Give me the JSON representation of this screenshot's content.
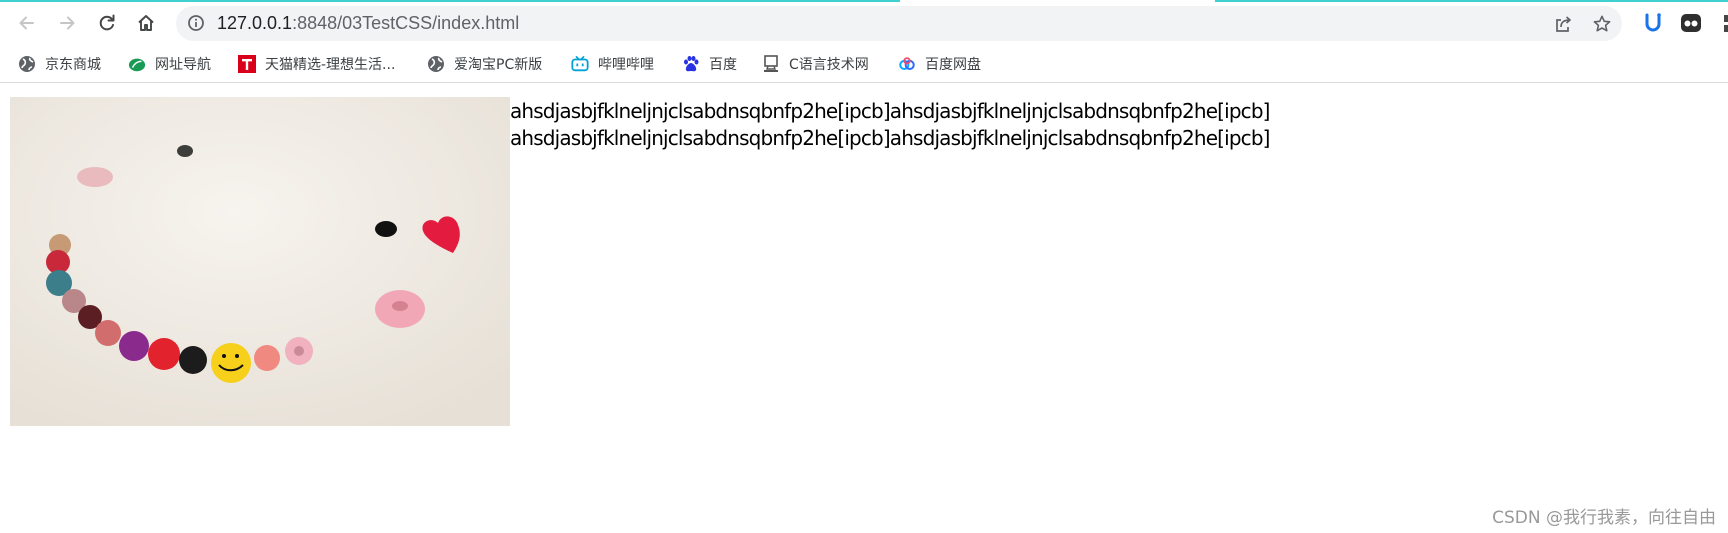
{
  "browser": {
    "url_host": "127.0.0.1",
    "url_rest": ":8848/03TestCSS/index.html",
    "accent_color": "#3fd1cf"
  },
  "bookmarks": [
    {
      "label": "京东商城",
      "icon": "globe-icon"
    },
    {
      "label": "网址导航",
      "icon": "navigation-leaf-icon"
    },
    {
      "label": "天猫精选-理想生活...",
      "icon": "tmall-icon"
    },
    {
      "label": "爱淘宝PC新版",
      "icon": "globe-icon"
    },
    {
      "label": "哔哩哔哩",
      "icon": "bilibili-icon"
    },
    {
      "label": "百度",
      "icon": "baidu-paw-icon"
    },
    {
      "label": "C语言技术网",
      "icon": "c-language-icon"
    },
    {
      "label": "百度网盘",
      "icon": "baidu-netdisk-icon"
    }
  ],
  "content": {
    "lines": [
      "ahsdjasbjfklneljnjclsabdnsqbnfp2he[ipcb]ahsdjasbjfklneljnjclsabdnsqbnfp2he[ipcb]",
      "ahsdjasbjfklneljnjclsabdnsqbnfp2he[ipcb]ahsdjasbjfklneljnjclsabdnsqbnfp2he[ipcb]"
    ],
    "image_subject": "buttons-smiley-photo"
  },
  "watermark": "CSDN @我行我素，向往自由"
}
